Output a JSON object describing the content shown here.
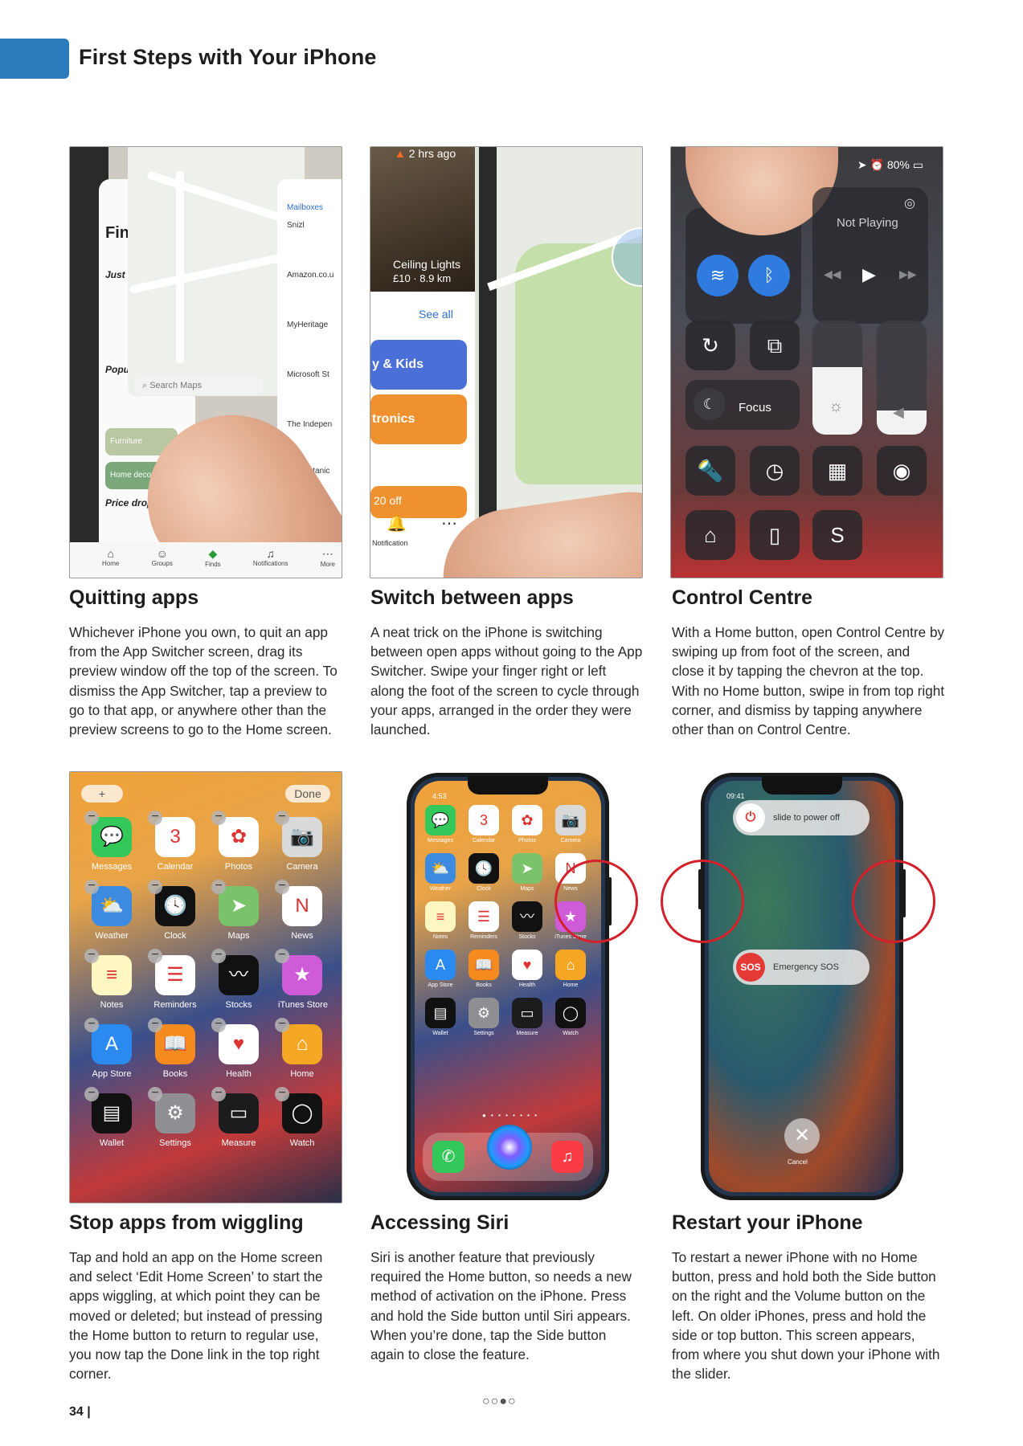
{
  "header": {
    "title": "First Steps with Your iPhone",
    "accent_color": "#2b7bbd"
  },
  "sections": [
    {
      "heading": "Quitting apps",
      "body": "Whichever iPhone you own, to quit an app from the App Switcher screen, drag its preview window off the top of the screen. To dismiss the App Switcher, tap a preview to go to that app, or anywhere other than the preview screens to go to the Home screen."
    },
    {
      "heading": "Switch between apps",
      "body": "A neat trick on the iPhone is switching between open apps without going to the App Switcher. Swipe your finger right or left along the foot of the screen to cycle through your apps, arranged in the order they were launched."
    },
    {
      "heading": "Control Centre",
      "body": "With a Home button, open Control Centre by swiping up from foot of the screen, and close it by tapping the chevron at the top. With no Home button, swipe in from top right corner, and dismiss by tapping anywhere other than on Control Centre."
    },
    {
      "heading": "Stop apps from wiggling",
      "body": "Tap and hold an app on the Home screen and select ‘Edit Home Screen’ to start the apps wiggling, at which point they can be moved or deleted; but instead of pressing the Home button to return to regular use, you now tap the Done link in the top right corner."
    },
    {
      "heading": "Accessing Siri",
      "body": "Siri is another feature that previously required the Home button, so needs a new method of activation on the iPhone. Press and hold the Side button until Siri appears. When you’re done, tap the Side button again to close the feature."
    },
    {
      "heading": "Restart your iPhone",
      "body": "To restart a newer iPhone with no Home button, press and hold both the Side button on the right and the Volume button on the left. On older iPhones, press and hold the side or top button. This screen appears, from where you shut down your iPhone with the slider."
    }
  ],
  "shot1": {
    "search_placeholder": "Search Maps",
    "mailboxes": "Mailboxes",
    "mail_items": [
      "Snizl",
      "Amazon.co.u",
      "MyHeritage",
      "Microsoft St",
      "The Indepen",
      "Satanic"
    ],
    "left_labels": [
      "Fin",
      "Just",
      "Popu",
      "Price drop"
    ],
    "chips": [
      "Furniture",
      "Home decor"
    ],
    "tabs": [
      "Home",
      "Groups",
      "Finds",
      "Notifications",
      "More"
    ]
  },
  "shot2": {
    "time_ago": "2 hrs ago",
    "item_title": "Ceiling Lights",
    "item_sub": "£10 · 8.9 km",
    "see_all": "See all",
    "tiles": [
      "y & Kids",
      "tronics"
    ],
    "offer": "20 off",
    "notifications": "Notification"
  },
  "shot3": {
    "battery": "80%",
    "not_playing": "Not Playing",
    "focus": "Focus"
  },
  "shot4": {
    "add": "+",
    "done": "Done",
    "apps": [
      {
        "label": "Messages",
        "icon": "💬",
        "color": "#34c759"
      },
      {
        "label": "Calendar",
        "icon": "3",
        "color": "#ffffff"
      },
      {
        "label": "Photos",
        "icon": "✿",
        "color": "#ffffff"
      },
      {
        "label": "Camera",
        "icon": "📷",
        "color": "#d9d9d9"
      },
      {
        "label": "Weather",
        "icon": "⛅",
        "color": "#3d8be0"
      },
      {
        "label": "Clock",
        "icon": "🕓",
        "color": "#111111"
      },
      {
        "label": "Maps",
        "icon": "➤",
        "color": "#7ac36a"
      },
      {
        "label": "News",
        "icon": "N",
        "color": "#ffffff"
      },
      {
        "label": "Notes",
        "icon": "≡",
        "color": "#fff7c2"
      },
      {
        "label": "Reminders",
        "icon": "☰",
        "color": "#ffffff"
      },
      {
        "label": "Stocks",
        "icon": "〰",
        "color": "#111111"
      },
      {
        "label": "iTunes Store",
        "icon": "★",
        "color": "#d05bd8"
      },
      {
        "label": "App Store",
        "icon": "A",
        "color": "#2a8af0"
      },
      {
        "label": "Books",
        "icon": "📖",
        "color": "#f58a1f"
      },
      {
        "label": "Health",
        "icon": "♥",
        "color": "#ffffff"
      },
      {
        "label": "Home",
        "icon": "⌂",
        "color": "#f5a623"
      },
      {
        "label": "Wallet",
        "icon": "▤",
        "color": "#111111"
      },
      {
        "label": "Settings",
        "icon": "⚙",
        "color": "#8e8e93"
      },
      {
        "label": "Measure",
        "icon": "▭",
        "color": "#1c1c1e"
      },
      {
        "label": "Watch",
        "icon": "◯",
        "color": "#111111"
      }
    ]
  },
  "shot5": {
    "time": "4:53"
  },
  "shot6": {
    "time": "09:41",
    "power_off": "slide to power off",
    "sos_knob": "SOS",
    "sos_label": "Emergency SOS",
    "cancel": "Cancel"
  },
  "footer": {
    "page_number": "34 |",
    "page_dots": "○○●○"
  }
}
